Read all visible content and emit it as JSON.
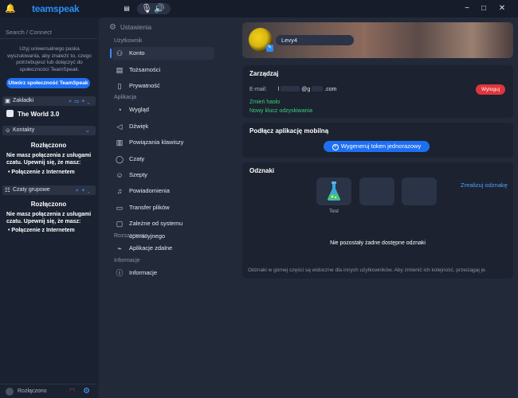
{
  "app": {
    "logo": "teamspeak",
    "window_controls": {
      "minimize": "−",
      "maximize": "□",
      "close": "✕"
    }
  },
  "left": {
    "search_placeholder": "Search / Connect",
    "hint": "Użyj uniwersalnego paska wyszukiwania, aby znaleźć to, czego potrzebujesz lub dołączyć do społeczności TeamSpeak.",
    "create_button": "Utwórz społeczność TeamSpeak",
    "bookmarks": {
      "label": "Zakładki",
      "server": "The World 3.0"
    },
    "contacts": {
      "label": "Kontakty",
      "status_title": "Rozłączono",
      "status_msg": "Nie masz połączenia z usługami czatu. Upewnij się, że masz:",
      "bullet": "Połączenie z Internetem"
    },
    "group_chats": {
      "label": "Czaty grupowe",
      "status_title": "Rozłączono",
      "status_msg": "Nie masz połączenia z usługami czatu. Upewnij się, że masz:",
      "bullet": "Połączenie z Internetem"
    },
    "status_bar": {
      "text": "Rozłączono",
      "status_color": "#e04646"
    }
  },
  "nav": {
    "title": "Ustawienia",
    "categories": {
      "user": "Użytkownik",
      "app": "Aplikacja",
      "extensions": "Rozszerzenia",
      "info": "Informacje"
    },
    "items": {
      "account": "Konto",
      "identities": "Tożsamości",
      "privacy": "Prywatność",
      "appearance": "Wygląd",
      "sound": "Dźwięk",
      "hotkeys": "Powiązania klawiszy",
      "chats": "Czaty",
      "whispers": "Szepty",
      "notifications": "Powiadomienia",
      "file_transfer": "Transfer plików",
      "os_specific": "Zależne od systemu operacyjnego",
      "remote_apps": "Aplikacje zdalne",
      "information": "Informacje"
    }
  },
  "profile": {
    "username": "Levy4"
  },
  "manage": {
    "title": "Zarządzaj",
    "email_label": "E-mail:",
    "email_prefix": "l",
    "email_mid": "@g",
    "email_suffix": ".com",
    "logout": "Wyloguj",
    "change_password": "Zmień hasło",
    "new_recovery_key": "Nowy klucz odzyskiwania"
  },
  "mobile": {
    "title": "Podłącz aplikację mobilną",
    "token_button": "Wygeneruj token jednorazowy"
  },
  "badges": {
    "title": "Odznaki",
    "redeem": "Zrealizuj odznakę",
    "slot1_label": "Test",
    "empty": "Nie pozostały żadne dostępne odznaki",
    "note": "Odznaki w górnej części są widoczne dla innych użytkowników. Aby zmienić ich kolejność, przeciągaj je."
  },
  "colors": {
    "accent": "#1d6ff2",
    "danger": "#e0353b",
    "success": "#3bd07a"
  }
}
